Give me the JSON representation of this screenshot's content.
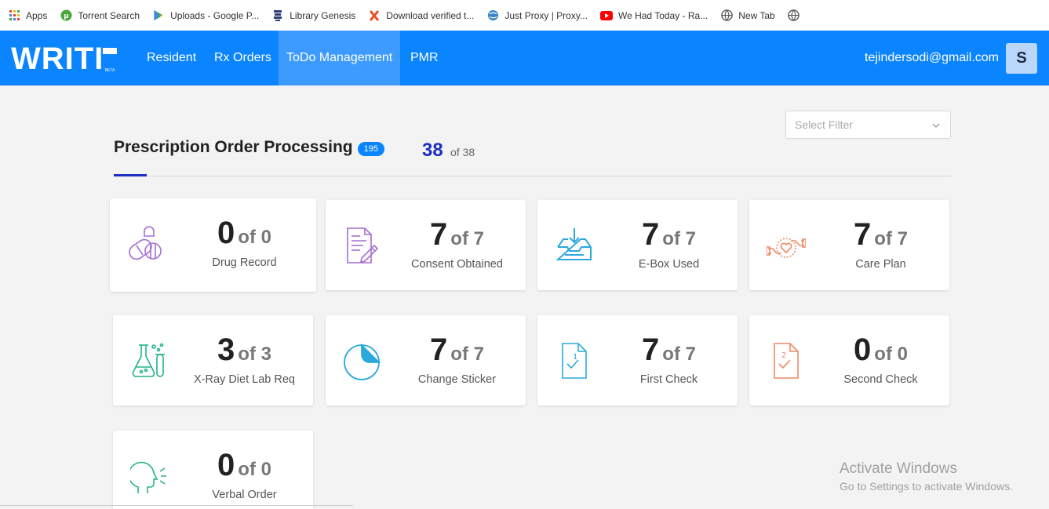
{
  "bookmarks": [
    {
      "label": "Apps",
      "icon": "apps-grid-icon"
    },
    {
      "label": "Torrent Search",
      "icon": "utorrent-icon"
    },
    {
      "label": "Uploads - Google P...",
      "icon": "google-play-icon"
    },
    {
      "label": "Library Genesis",
      "icon": "library-icon"
    },
    {
      "label": "Download verified t...",
      "icon": "x-icon"
    },
    {
      "label": "Just Proxy | Proxy...",
      "icon": "globe-icon"
    },
    {
      "label": "We Had Today - Ra...",
      "icon": "youtube-icon"
    },
    {
      "label": "New Tab",
      "icon": "globe-icon"
    }
  ],
  "navbar": {
    "logo_text": "WRITI",
    "logo_beta": "BETA",
    "items": [
      "Resident",
      "Rx Orders",
      "ToDo Management",
      "PMR"
    ],
    "active": "ToDo Management",
    "user_email": "tejindersodi@gmail.com",
    "avatar_letter": "S",
    "color": "#0a84ff"
  },
  "filter": {
    "placeholder": "Select Filter"
  },
  "header": {
    "title": "Prescription Order Processing",
    "badge": "195",
    "count": "38",
    "count_of": "of 38"
  },
  "cards": [
    {
      "value": "0",
      "of": "of 0",
      "label": "Drug Record",
      "icon": "pills-icon",
      "color": "#a66fd1"
    },
    {
      "value": "7",
      "of": "of 7",
      "label": "Consent Obtained",
      "icon": "document-pen-icon",
      "color": "#a66fd1"
    },
    {
      "value": "7",
      "of": "of 7",
      "label": "E-Box Used",
      "icon": "inbox-download-icon",
      "color": "#2ba9dd"
    },
    {
      "value": "7",
      "of": "of 7",
      "label": "Care Plan",
      "icon": "care-hands-heart-icon",
      "color": "#ee8a66"
    },
    {
      "value": "3",
      "of": "of 3",
      "label": "X-Ray Diet Lab Req",
      "icon": "lab-flasks-icon",
      "color": "#23b38b"
    },
    {
      "value": "7",
      "of": "of 7",
      "label": "Change Sticker",
      "icon": "sticker-icon",
      "color": "#2ba9dd"
    },
    {
      "value": "7",
      "of": "of 7",
      "label": "First Check",
      "icon": "document-check-1-icon",
      "color": "#2ba9dd"
    },
    {
      "value": "0",
      "of": "of 0",
      "label": "Second Check",
      "icon": "document-check-2-icon",
      "color": "#ee8a66"
    },
    {
      "value": "0",
      "of": "of 0",
      "label": "Verbal Order",
      "icon": "speaking-head-icon",
      "color": "#23b38b"
    }
  ],
  "watermark": {
    "line1": "Activate Windows",
    "line2": "Go to Settings to activate Windows."
  }
}
